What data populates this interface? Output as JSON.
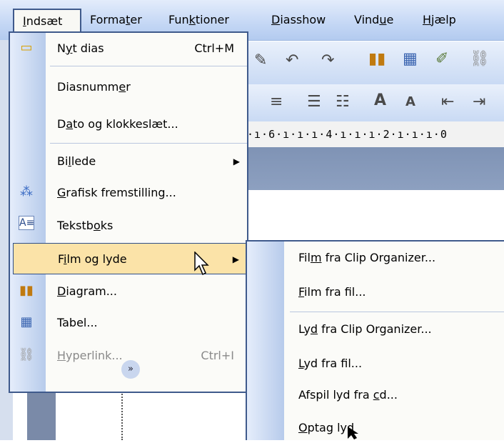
{
  "menubar": {
    "items": [
      "Indsæt",
      "Formater",
      "Funktioner",
      "Diasshow",
      "Vindue",
      "Hjælp"
    ],
    "mnemonics": [
      "I",
      "t",
      "k",
      "D",
      "u",
      "H"
    ]
  },
  "ruler_text": "·ı·6·ı·ı·ı·4·ı·ı·ı·2·ı·ı·ı·0",
  "insert_menu": {
    "new_slide": {
      "pre": "N",
      "u": "y",
      "post": "t dias",
      "shortcut": "Ctrl+M"
    },
    "slide_number": {
      "pre": "Diasnumm",
      "u": "e",
      "post": "r"
    },
    "date_time": {
      "pre": "D",
      "u": "a",
      "post": "to og klokkeslæt..."
    },
    "picture": {
      "pre": "Bi",
      "u": "l",
      "post": "lede"
    },
    "chart_org": {
      "pre": "",
      "u": "G",
      "post": "rafisk fremstilling..."
    },
    "textbox": {
      "pre": "Tekstb",
      "u": "o",
      "post": "ks"
    },
    "movies_sounds": {
      "pre": "F",
      "u": "i",
      "post": "lm og lyde"
    },
    "diagram": {
      "pre": "",
      "u": "D",
      "post": "iagram..."
    },
    "table": {
      "pre": "Tabel",
      "u": "",
      "post": "..."
    },
    "hyperlink": {
      "pre": "",
      "u": "H",
      "post": "yperlink...",
      "shortcut": "Ctrl+I"
    }
  },
  "sub_menu": {
    "film_clip": {
      "pre": "Fil",
      "u": "m",
      "post": " fra Clip Organizer..."
    },
    "film_file": {
      "pre": "",
      "u": "F",
      "post": "ilm fra fil..."
    },
    "sound_clip": {
      "pre": "Ly",
      "u": "d",
      "post": " fra Clip Organizer..."
    },
    "sound_file": {
      "pre": "",
      "u": "L",
      "post": "yd fra fil..."
    },
    "cd_audio": {
      "pre": "Afspil lyd fra ",
      "u": "c",
      "post": "d..."
    },
    "record_sound": {
      "pre": "",
      "u": "O",
      "post": "ptag lyd"
    }
  },
  "icons": {
    "new_slide": "new-slide-icon",
    "chart_org": "org-chart-icon",
    "textbox": "textbox-icon",
    "diagram": "chart-icon",
    "table": "table-icon",
    "hyperlink": "hyperlink-icon",
    "expand": "expand-chevron-icon",
    "submenu_arrow": "submenu-arrow-icon"
  },
  "colors": {
    "highlight": "#fbe3a8",
    "menu_border": "#3f5a8c",
    "disabled_text": "#8a8a8a"
  }
}
